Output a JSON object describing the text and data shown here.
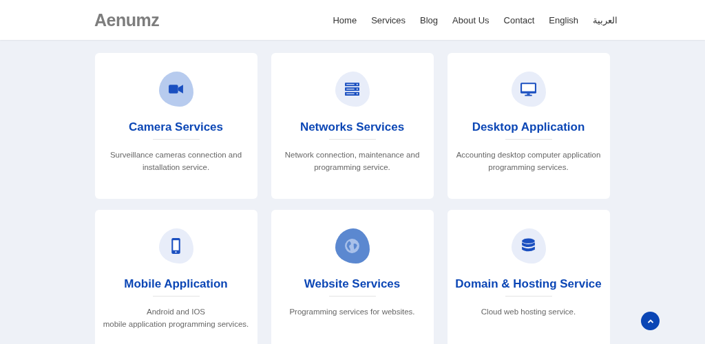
{
  "header": {
    "logo": "Aenumz",
    "nav": [
      {
        "label": "Home"
      },
      {
        "label": "Services"
      },
      {
        "label": "Blog"
      },
      {
        "label": "About Us"
      },
      {
        "label": "Contact"
      },
      {
        "label": "English"
      },
      {
        "label": "العربية"
      }
    ]
  },
  "services": [
    {
      "kind": "camera",
      "color": "#b7cbee",
      "title": "Camera Services",
      "description": [
        "Surveillance cameras connection and installation service."
      ]
    },
    {
      "kind": "server",
      "color": "#e8edf9",
      "title": "Networks Services",
      "description": [
        "Network connection, maintenance and programming service."
      ]
    },
    {
      "kind": "desktop",
      "color": "#e8edf9",
      "title": "Desktop Application",
      "description": [
        "Accounting desktop computer application programming services."
      ]
    },
    {
      "kind": "mobile",
      "color": "#e8edf9",
      "title": "Mobile Application",
      "description": [
        "Android and IOS",
        "mobile application programming services."
      ]
    },
    {
      "kind": "globe",
      "color": "#5b88d0",
      "title": "Website Services",
      "description": [
        "Programming services for websites."
      ]
    },
    {
      "kind": "database",
      "color": "#e8edf9",
      "title": "Domain & Hosting Service",
      "description": [
        "Cloud web hosting service."
      ]
    }
  ]
}
